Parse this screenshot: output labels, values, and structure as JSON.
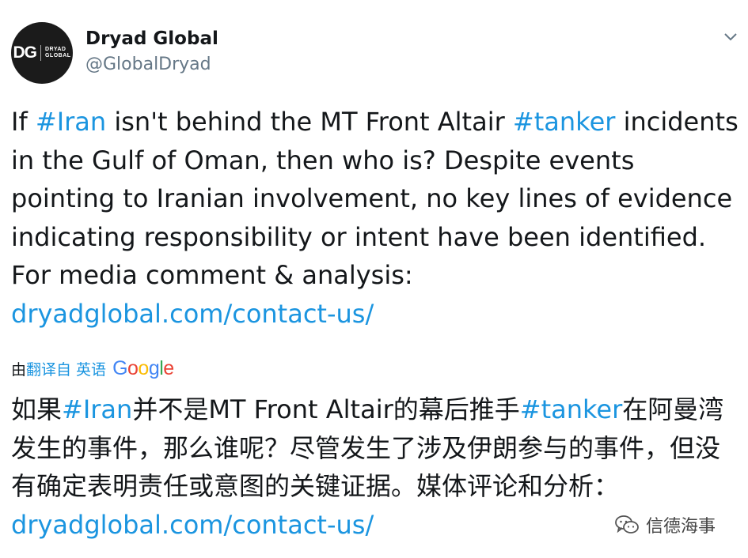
{
  "author": {
    "name": "Dryad Global",
    "handle": "@GlobalDryad",
    "avatar_logo": {
      "mark": "DG",
      "line1": "DRYAD",
      "line2": "GLOBAL"
    }
  },
  "tweet": {
    "t1": "If ",
    "hashtag_iran": "#Iran",
    "t2": " isn't behind the MT Front Altair ",
    "hashtag_tanker": "#tanker",
    "t3": " incidents in the Gulf of Oman, then who is? Despite events pointing to Iranian involvement, no key lines of evidence indicating responsibility or intent have been identified. For media comment & analysis: ",
    "link": "dryadglobal.com/contact-us/"
  },
  "translation_bar": {
    "by": "由",
    "translated_from": "翻译自 英语",
    "google": {
      "G": "G",
      "o1": "o",
      "o2": "o",
      "g": "g",
      "l": "l",
      "e": "e"
    }
  },
  "translation": {
    "t1": "如果",
    "hashtag_iran": "#Iran",
    "t2": "并不是MT Front Altair的幕后推手",
    "hashtag_tanker": "#tanker",
    "t3": "在阿曼湾发生的事件，那么谁呢？尽管发生了涉及伊朗参与的事件，但没有确定表明责任或意图的关键证据。媒体评论和分析： ",
    "link": "dryadglobal.com/contact-us/"
  },
  "watermark": {
    "text": "信德海事",
    "icon": "wechat-icon"
  },
  "colors": {
    "link": "#1b95e0",
    "text": "#14171a",
    "secondary": "#657786"
  }
}
